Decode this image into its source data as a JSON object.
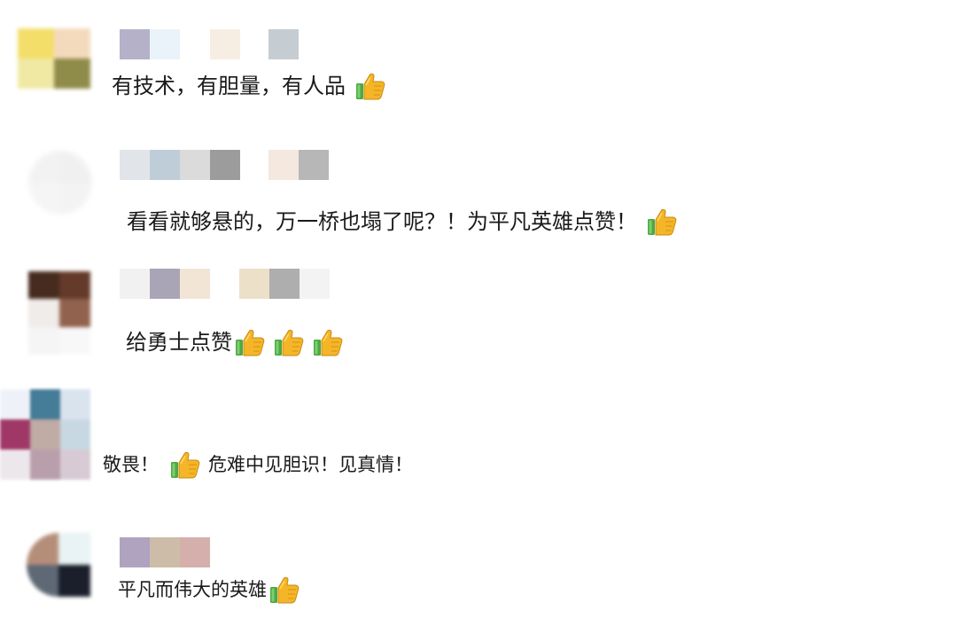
{
  "comments": [
    {
      "avatar_colors": [
        "#f3dd62",
        "#f4d9b9",
        "#f0e8a0",
        "#8a8540"
      ],
      "name_colors": [
        "#b4b1c9",
        "#eaf3f9",
        "#f6eee2",
        "#c6cdd2"
      ],
      "text": "有技术，有胆量，有人品",
      "thumbs_count": 1
    },
    {
      "avatar_colors": [
        "#f2f2f2",
        "#f0f0f0",
        "#f5f5f5",
        "#f3f3f3"
      ],
      "name_colors": [
        "#e1e5ea",
        "#bfcdd9",
        "#dbdbdb",
        "#9c9c9c",
        "#f4e8df",
        "#b7b7b7"
      ],
      "text": "看看就够悬的，万一桥也塌了呢？！为平凡英雄点赞！",
      "thumbs_count": 1
    },
    {
      "avatar_colors": [
        "#3d2012",
        "#5c3020",
        "#f0ebe8",
        "#8c5a45"
      ],
      "name_colors": [
        "#f1f1f1",
        "#aaa5b6",
        "#f2e5d5",
        "#ede0c8",
        "#aeaeae",
        "#f3f3f3"
      ],
      "text": "给勇士点赞",
      "thumbs_count": 3
    },
    {
      "avatar_colors": [
        "#d8e2ee",
        "#3c7593",
        "#9a2e5e",
        "#bda7a1"
      ],
      "name_colors": [],
      "text_before": "敬畏！",
      "text_after": "危难中见胆识！见真情！",
      "thumbs_count": 1
    },
    {
      "avatar_colors": [
        "#b28873",
        "#e8f2f4",
        "#56626e",
        "#0e1420"
      ],
      "name_colors": [
        "#b0a3bf",
        "#cdbca8",
        "#d4afac"
      ],
      "text": "平凡而伟大的英雄",
      "thumbs_count": 1
    }
  ],
  "icons": {
    "thumb": "thumbs-up-icon"
  },
  "colors": {
    "thumb_gold": "#f4b628",
    "thumb_green": "#4ea844"
  }
}
